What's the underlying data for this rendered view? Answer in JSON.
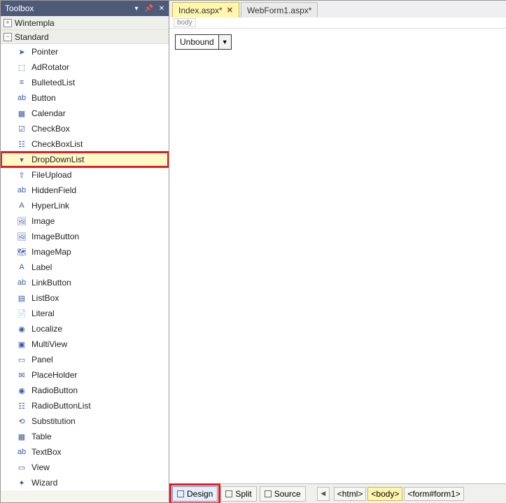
{
  "toolbox": {
    "title": "Toolbox",
    "groups": {
      "g0": {
        "name": "Wintempla",
        "expanded": false
      },
      "g1": {
        "name": "Standard",
        "expanded": true
      }
    },
    "items": [
      {
        "label": "Pointer",
        "icon": "➤"
      },
      {
        "label": "AdRotator",
        "icon": "⬚"
      },
      {
        "label": "BulletedList",
        "icon": "≡"
      },
      {
        "label": "Button",
        "icon": "ab"
      },
      {
        "label": "Calendar",
        "icon": "▦"
      },
      {
        "label": "CheckBox",
        "icon": "☑"
      },
      {
        "label": "CheckBoxList",
        "icon": "☷"
      },
      {
        "label": "DropDownList",
        "icon": "▾"
      },
      {
        "label": "FileUpload",
        "icon": "⇪"
      },
      {
        "label": "HiddenField",
        "icon": "ab"
      },
      {
        "label": "HyperLink",
        "icon": "A"
      },
      {
        "label": "Image",
        "icon": "🖼"
      },
      {
        "label": "ImageButton",
        "icon": "🖼"
      },
      {
        "label": "ImageMap",
        "icon": "🗺"
      },
      {
        "label": "Label",
        "icon": "A"
      },
      {
        "label": "LinkButton",
        "icon": "ab"
      },
      {
        "label": "ListBox",
        "icon": "▤"
      },
      {
        "label": "Literal",
        "icon": "📄"
      },
      {
        "label": "Localize",
        "icon": "◉"
      },
      {
        "label": "MultiView",
        "icon": "▣"
      },
      {
        "label": "Panel",
        "icon": "▭"
      },
      {
        "label": "PlaceHolder",
        "icon": "✉"
      },
      {
        "label": "RadioButton",
        "icon": "◉"
      },
      {
        "label": "RadioButtonList",
        "icon": "☷"
      },
      {
        "label": "Substitution",
        "icon": "⟲"
      },
      {
        "label": "Table",
        "icon": "▦"
      },
      {
        "label": "TextBox",
        "icon": "ab"
      },
      {
        "label": "View",
        "icon": "▭"
      },
      {
        "label": "Wizard",
        "icon": "✦"
      }
    ],
    "selected_index": 7
  },
  "editor": {
    "tabs": [
      {
        "label": "Index.aspx*",
        "active": true
      },
      {
        "label": "WebForm1.aspx*",
        "active": false
      }
    ],
    "tagpath": "body",
    "dropdown_text": "Unbound"
  },
  "statusbar": {
    "views": [
      {
        "label": "Design",
        "active": true,
        "highlighted": true
      },
      {
        "label": "Split",
        "active": false,
        "highlighted": false
      },
      {
        "label": "Source",
        "active": false,
        "highlighted": false
      }
    ],
    "crumbs": [
      {
        "label": "<html>",
        "selected": false
      },
      {
        "label": "<body>",
        "selected": true
      },
      {
        "label": "<form#form1>",
        "selected": false
      }
    ]
  }
}
